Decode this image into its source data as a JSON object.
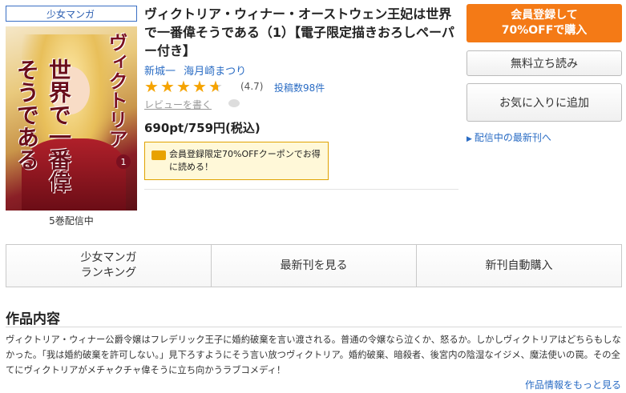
{
  "genre_tag": "少女マンガ",
  "cover": {
    "title_vertical_1": "ヴィクトリア",
    "title_vertical_2": "世界で一番偉そうである",
    "volume_badge": "1"
  },
  "volume_count": "5巻配信中",
  "book": {
    "title": "ヴィクトリア・ウィナー・オーストウェン王妃は世界で一番偉そうである（1）【電子限定描きおろしペーパー付き】",
    "authors": [
      "新城一",
      "海月崎まつり"
    ],
    "rating": 4.7,
    "rating_label": "(4.7)",
    "review_count": "投稿数98件",
    "write_review": "レビューを書く",
    "price": "690pt/759円(税込)",
    "coupon_text": "会員登録限定70%OFFクーポンでお得に読める！"
  },
  "actions": {
    "register_line1": "会員登録して",
    "register_line2": "70%OFFで購入",
    "free_read": "無料立ち読み",
    "add_favorite": "お気に入りに追加",
    "latest_link": "配信中の最新刊へ"
  },
  "tabs": [
    {
      "label_line1": "少女マンガ",
      "label_line2": "ランキング"
    },
    {
      "label_line1": "最新刊を見る",
      "label_line2": ""
    },
    {
      "label_line1": "新刊自動購入",
      "label_line2": ""
    }
  ],
  "description": {
    "heading": "作品内容",
    "body": "ヴィクトリア・ウィナー公爵令嬢はフレデリック王子に婚約破棄を言い渡される。普通の令嬢なら泣くか、怒るか。しかしヴィクトリアはどちらもしなかった。「我は婚約破棄を許可しない。」見下ろすようにそう言い放つヴィクトリア。婚約破棄、暗殺者、後宮内の陰湿なイジメ、魔法使いの罠。その全てにヴィクトリアがメチャクチャ偉そうに立ち向かうラブコメディ！",
    "more_link": "作品情報をもっと見る"
  },
  "colors": {
    "accent_orange": "#f47a16",
    "link_blue": "#2a6cc4",
    "star": "#f5a300"
  }
}
